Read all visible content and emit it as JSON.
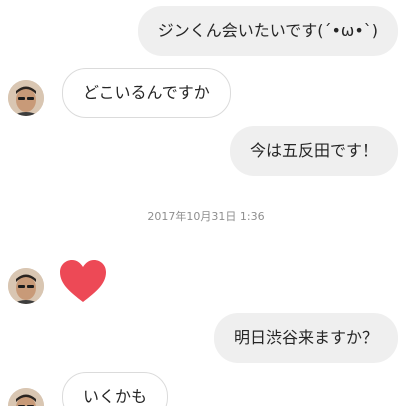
{
  "messages": [
    {
      "text": "ジンくん会いたいです(´•ω•`)"
    },
    {
      "text": "どこいるんですか"
    },
    {
      "text": "今は五反田です！"
    },
    {
      "text": "明日渋谷来ますか？"
    },
    {
      "text": "いくかも"
    }
  ],
  "timestamp": "2017年10月31日 1:36",
  "colors": {
    "outgoing_bubble": "#efefef",
    "incoming_border": "#dbdbdb",
    "heart": "#ed4956",
    "timestamp_text": "#8e8e8e"
  },
  "icons": {
    "heart": "heart-icon",
    "avatar": "profile-avatar"
  }
}
